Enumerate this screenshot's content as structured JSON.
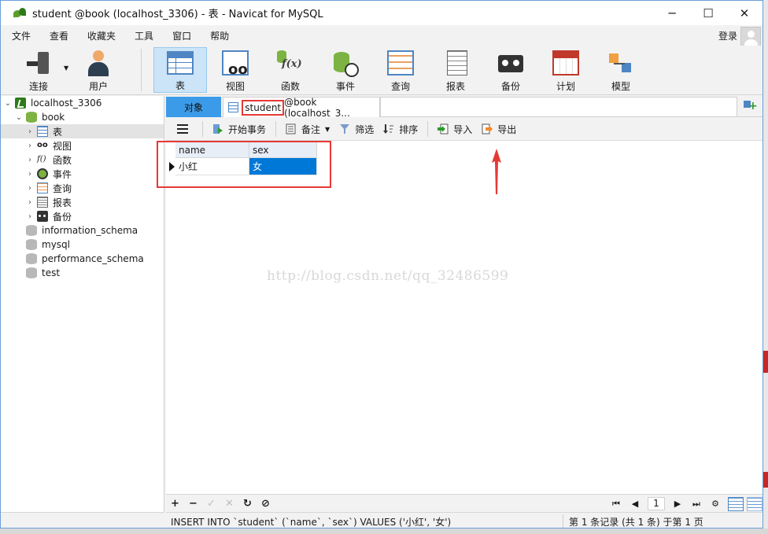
{
  "window": {
    "title": "student @book (localhost_3306) - 表 - Navicat for MySQL",
    "minimize": "─",
    "maximize": "☐",
    "close": "✕"
  },
  "menu": {
    "items": [
      "文件",
      "查看",
      "收藏夹",
      "工具",
      "窗口",
      "帮助"
    ],
    "login": "登录"
  },
  "toolbar": {
    "items": [
      {
        "label": "连接",
        "icon": "connect-icon"
      },
      {
        "label": "用户",
        "icon": "user-icon"
      },
      {
        "label": "表",
        "icon": "table-icon",
        "active": true
      },
      {
        "label": "视图",
        "icon": "view-icon"
      },
      {
        "label": "函数",
        "icon": "function-icon"
      },
      {
        "label": "事件",
        "icon": "event-icon"
      },
      {
        "label": "查询",
        "icon": "query-icon"
      },
      {
        "label": "报表",
        "icon": "report-icon"
      },
      {
        "label": "备份",
        "icon": "backup-icon"
      },
      {
        "label": "计划",
        "icon": "schedule-icon"
      },
      {
        "label": "模型",
        "icon": "model-icon"
      }
    ]
  },
  "sidebar": {
    "connection": "localhost_3306",
    "database": "book",
    "items": [
      "表",
      "视图",
      "函数",
      "事件",
      "查询",
      "报表",
      "备份"
    ],
    "other_databases": [
      "information_schema",
      "mysql",
      "performance_schema",
      "test"
    ]
  },
  "tabs": {
    "objects": "对象",
    "table_name": "student",
    "table_suffix": " @book (localhost_3..."
  },
  "subtoolbar": {
    "begin_transaction": "开始事务",
    "memo": "备注",
    "filter": "筛选",
    "sort": "排序",
    "import": "导入",
    "export": "导出"
  },
  "grid": {
    "columns": [
      "name",
      "sex"
    ],
    "rows": [
      [
        "小红",
        "女"
      ]
    ]
  },
  "watermark": "http://blog.csdn.net/qq_32486599",
  "navbar": {
    "add": "+",
    "remove": "−",
    "apply": "✓",
    "cancel": "✕",
    "refresh": "↻",
    "stop": "⊘",
    "page": "1"
  },
  "status": {
    "sql": "INSERT INTO `student` (`name`, `sex`) VALUES ('小红', '女')",
    "info": "第 1 条记录 (共 1 条) 于第 1 页"
  },
  "colors": {
    "accent": "#0078d7",
    "tab_active": "#3c9be8",
    "highlight": "#e53935"
  }
}
